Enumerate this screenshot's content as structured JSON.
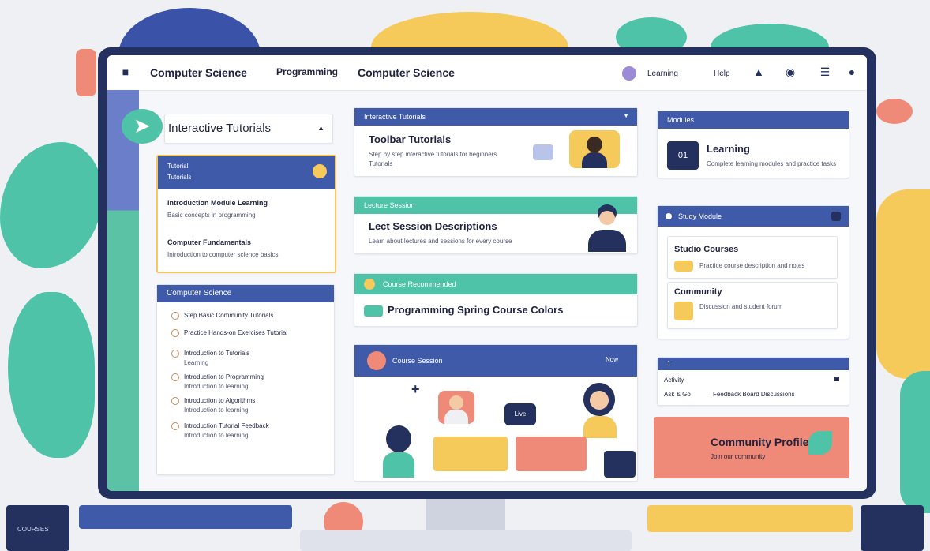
{
  "nav": {
    "brand_title": "Computer Science",
    "tab_programming": "Programming",
    "tab_cs": "Computer Science",
    "right_link_1": "Learning",
    "right_link_2": "Help"
  },
  "interactive_tutorials": {
    "title": "Interactive Tutorials"
  },
  "tutorial_list_card": {
    "header_line1": "Tutorial",
    "header_line2": "Tutorials",
    "item1_title": "Introduction Module Learning",
    "item1_sub": "Basic concepts in programming",
    "item2_title": "Computer Fundamentals",
    "item2_sub": "Introduction to computer science basics"
  },
  "cs_list_card": {
    "header": "Computer Science",
    "items": [
      {
        "title": "Step Basic Community Tutorials"
      },
      {
        "title": "Practice Hands-on Exercises Tutorial"
      },
      {
        "title": "Introduction to Tutorials",
        "sub": "Learning"
      },
      {
        "title": "Introduction to Programming",
        "sub": "Introduction to learning"
      },
      {
        "title": "Introduction to Algorithms",
        "sub": "Introduction to learning"
      },
      {
        "title": "Introduction Tutorial Feedback",
        "sub": "Introduction to learning"
      }
    ]
  },
  "toolbar_tutorials_card": {
    "header": "Interactive Tutorials",
    "title": "Toolbar Tutorials",
    "sub_1": "Step by step interactive tutorials for beginners",
    "sub_2": "Tutorials"
  },
  "lecture_card": {
    "header": "Lecture Session",
    "title": "Lect Session Descriptions",
    "sub": "Learn about lectures and sessions for every course"
  },
  "course_card": {
    "header": "Course Recommended",
    "title": "Programming Spring Course Colors"
  },
  "session_card": {
    "header": "Course Session",
    "header_right": "Now",
    "bubble_text": "Live"
  },
  "learning_card": {
    "header": "Modules",
    "badge": "01",
    "title": "Learning",
    "sub": "Complete learning modules and practice tasks"
  },
  "study_card": {
    "header": "Study Module",
    "item1_title": "Studio Courses",
    "item1_sub": "Practice course description and notes",
    "item2_title": "Community",
    "item2_sub": "Discussion and student forum"
  },
  "small_card": {
    "header": "1",
    "row1": "Activity",
    "row2_left": "Ask & Go",
    "row2_right": "Feedback Board Discussions"
  },
  "community_banner": {
    "title": "Community Profile",
    "sub": "Join our community"
  },
  "footer_panel": {
    "label": "COURSES"
  },
  "colors": {
    "navy": "#24305e",
    "blue": "#3f5aa8",
    "teal": "#4fc3a8",
    "yellow": "#f5c95a",
    "coral": "#f08a78"
  }
}
